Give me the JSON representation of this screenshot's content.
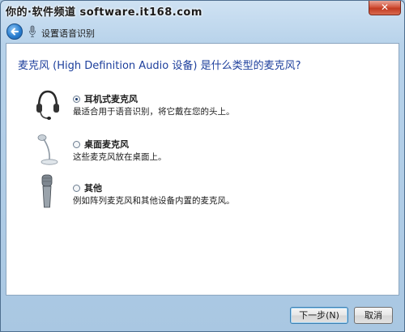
{
  "titlebar": {
    "watermark": "你的·软件频道 software.it168.com",
    "close_glyph": "✕"
  },
  "nav": {
    "title": "设置语音识别",
    "back_icon": "back-arrow-icon",
    "mic_icon": "microphone-icon"
  },
  "main": {
    "question": "麦克风 (High Definition Audio 设备) 是什么类型的麦克风?",
    "options": [
      {
        "label": "耳机式麦克风",
        "description": "最适合用于语音识别，将它戴在您的头上。",
        "selected": true,
        "icon": "headset-microphone-icon"
      },
      {
        "label": "桌面麦克风",
        "description": "这些麦克风放在桌面上。",
        "selected": false,
        "icon": "desktop-microphone-icon"
      },
      {
        "label": "其他",
        "description": "例如阵列麦克风和其他设备内置的麦克风。",
        "selected": false,
        "icon": "handheld-microphone-icon"
      }
    ]
  },
  "footer": {
    "next_label": "下一步(N)",
    "cancel_label": "取消"
  },
  "colors": {
    "question_text": "#1d3f9c",
    "close_button": "#c23b22",
    "window_frame": "#b7d2ea"
  }
}
